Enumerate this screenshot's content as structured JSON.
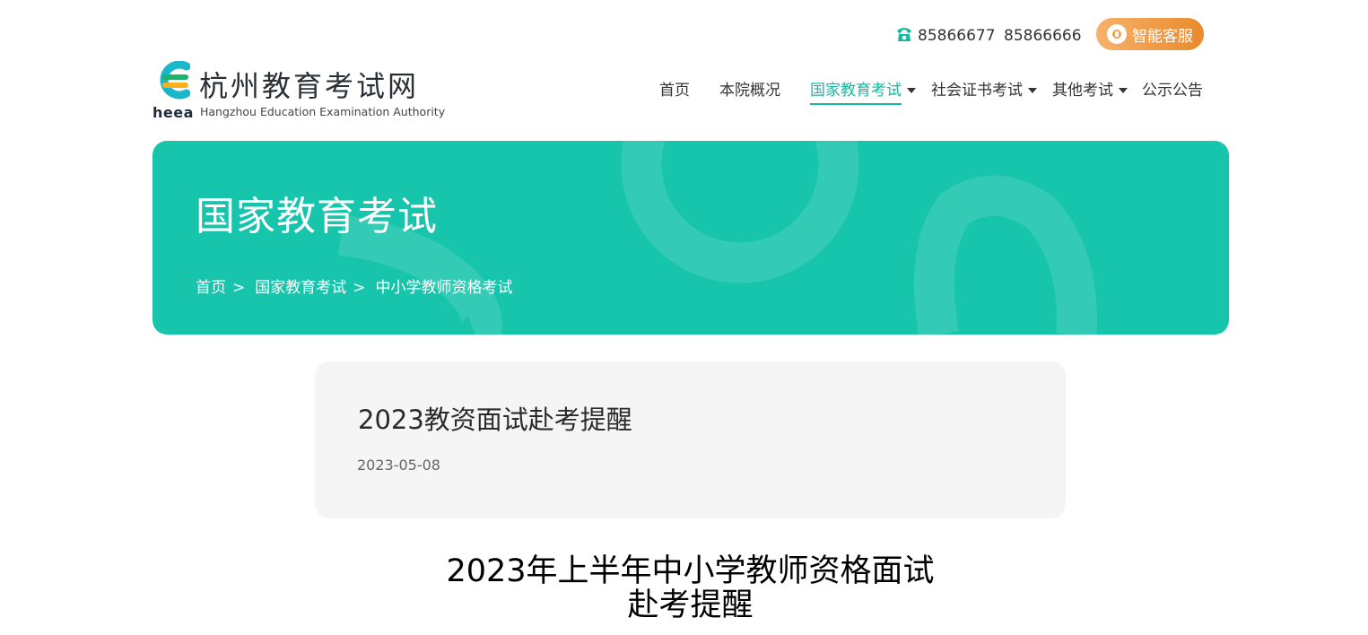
{
  "topbar": {
    "phones": [
      "85866677",
      "85866666"
    ],
    "service_label": "智能客服"
  },
  "logo": {
    "cn": "杭州教育考试网",
    "en": "Hangzhou Education Examination Authority",
    "abbr": "heea"
  },
  "nav": [
    {
      "label": "首页",
      "active": false,
      "dropdown": false
    },
    {
      "label": "本院概况",
      "active": false,
      "dropdown": false
    },
    {
      "label": "国家教育考试",
      "active": true,
      "dropdown": true
    },
    {
      "label": "社会证书考试",
      "active": false,
      "dropdown": true
    },
    {
      "label": "其他考试",
      "active": false,
      "dropdown": true
    },
    {
      "label": "公示公告",
      "active": false,
      "dropdown": false
    }
  ],
  "banner": {
    "title": "国家教育考试",
    "breadcrumb": [
      "首页",
      "国家教育考试",
      "中小学教师资格考试"
    ],
    "breadcrumb_sep": ">"
  },
  "article": {
    "title": "2023教资面试赴考提醒",
    "date": "2023-05-08",
    "heading_lines": [
      "2023年上半年中小学教师资格面试",
      "赴考提醒"
    ]
  },
  "colors": {
    "accent": "#16b8a0",
    "banner": "#17c4ac",
    "service_gradient": [
      "#f6b26b",
      "#e98a2c"
    ],
    "card_bg": "#f5f5f5"
  }
}
